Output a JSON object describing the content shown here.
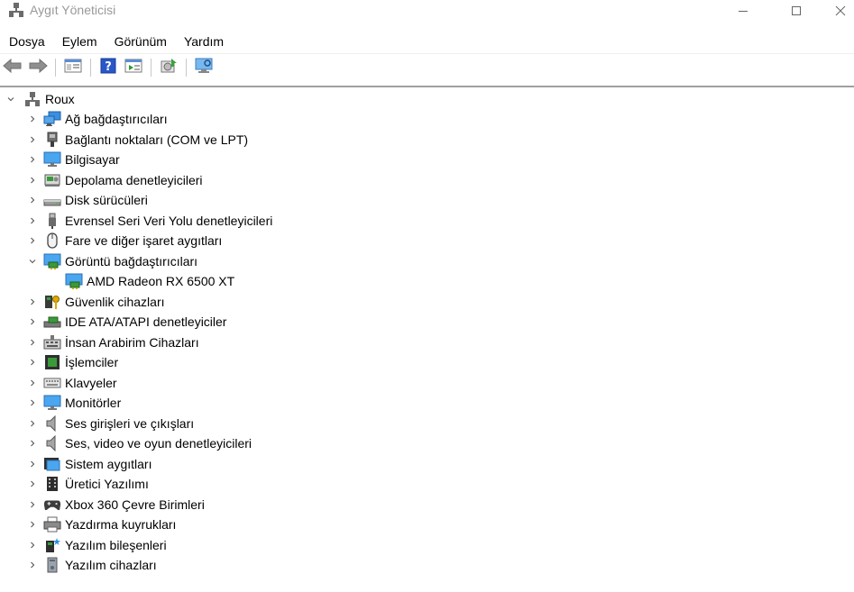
{
  "window": {
    "title": "Aygıt Yöneticisi",
    "icon": "device-manager-icon"
  },
  "menu": [
    "Dosya",
    "Eylem",
    "Görünüm",
    "Yardım"
  ],
  "toolbar": [
    "back-icon",
    "forward-icon",
    "properties-list-icon",
    "help-icon",
    "show-hidden-icon",
    "update-driver-icon",
    "scan-hardware-icon"
  ],
  "tree": {
    "root": {
      "label": "Roux",
      "expanded": true,
      "icon": "computer-network-icon"
    },
    "categories": [
      {
        "label": "Ağ bağdaştırıcıları",
        "icon": "network-adapter-icon",
        "expanded": false
      },
      {
        "label": "Bağlantı noktaları (COM ve LPT)",
        "icon": "port-icon",
        "expanded": false
      },
      {
        "label": "Bilgisayar",
        "icon": "computer-icon",
        "expanded": false
      },
      {
        "label": "Depolama denetleyicileri",
        "icon": "storage-controller-icon",
        "expanded": false
      },
      {
        "label": "Disk sürücüleri",
        "icon": "disk-drive-icon",
        "expanded": false
      },
      {
        "label": "Evrensel Seri Veri Yolu denetleyicileri",
        "icon": "usb-icon",
        "expanded": false
      },
      {
        "label": "Fare ve diğer işaret aygıtları",
        "icon": "mouse-icon",
        "expanded": false
      },
      {
        "label": "Görüntü bağdaştırıcıları",
        "icon": "display-adapter-icon",
        "expanded": true,
        "children": [
          {
            "label": "AMD Radeon RX 6500 XT",
            "icon": "display-adapter-icon"
          }
        ]
      },
      {
        "label": "Güvenlik cihazları",
        "icon": "security-device-icon",
        "expanded": false
      },
      {
        "label": "IDE ATA/ATAPI denetleyiciler",
        "icon": "ide-controller-icon",
        "expanded": false
      },
      {
        "label": "İnsan Arabirim Cihazları",
        "icon": "hid-icon",
        "expanded": false
      },
      {
        "label": "İşlemciler",
        "icon": "processor-icon",
        "expanded": false
      },
      {
        "label": "Klavyeler",
        "icon": "keyboard-icon",
        "expanded": false
      },
      {
        "label": "Monitörler",
        "icon": "monitor-icon",
        "expanded": false
      },
      {
        "label": "Ses girişleri ve çıkışları",
        "icon": "speaker-icon",
        "expanded": false
      },
      {
        "label": "Ses, video ve oyun denetleyicileri",
        "icon": "speaker-icon",
        "expanded": false
      },
      {
        "label": "Sistem aygıtları",
        "icon": "system-device-icon",
        "expanded": false
      },
      {
        "label": "Üretici Yazılımı",
        "icon": "firmware-icon",
        "expanded": false
      },
      {
        "label": "Xbox 360 Çevre Birimleri",
        "icon": "gamepad-icon",
        "expanded": false
      },
      {
        "label": "Yazdırma kuyrukları",
        "icon": "printer-icon",
        "expanded": false
      },
      {
        "label": "Yazılım bileşenleri",
        "icon": "software-component-icon",
        "expanded": false
      },
      {
        "label": "Yazılım cihazları",
        "icon": "software-device-icon",
        "expanded": false
      }
    ]
  }
}
